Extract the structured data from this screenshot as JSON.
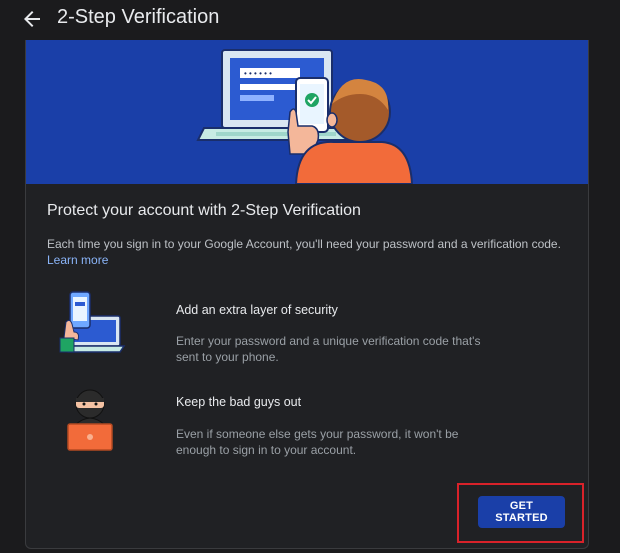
{
  "header": {
    "title": "2-Step Verification",
    "back_icon": "arrow-back-icon"
  },
  "main": {
    "headline": "Protect your account with 2-Step Verification",
    "intro": "Each time you sign in to your Google Account, you'll need your password and a verification code.",
    "learn_more": "Learn more",
    "features": [
      {
        "title": "Add an extra layer of security",
        "description": "Enter your password and a unique verification code that's sent to your phone.",
        "icon": "phone-laptop-icon"
      },
      {
        "title": "Keep the bad guys out",
        "description": "Even if someone else gets your password, it won't be enough to sign in to your account.",
        "icon": "hacker-laptop-icon"
      }
    ],
    "cta_label": "GET STARTED"
  },
  "colors": {
    "background": "#1b1b1d",
    "card": "#202124",
    "accent": "#1a3fa8",
    "link": "#8ab4f8",
    "highlight": "#d9222a"
  }
}
